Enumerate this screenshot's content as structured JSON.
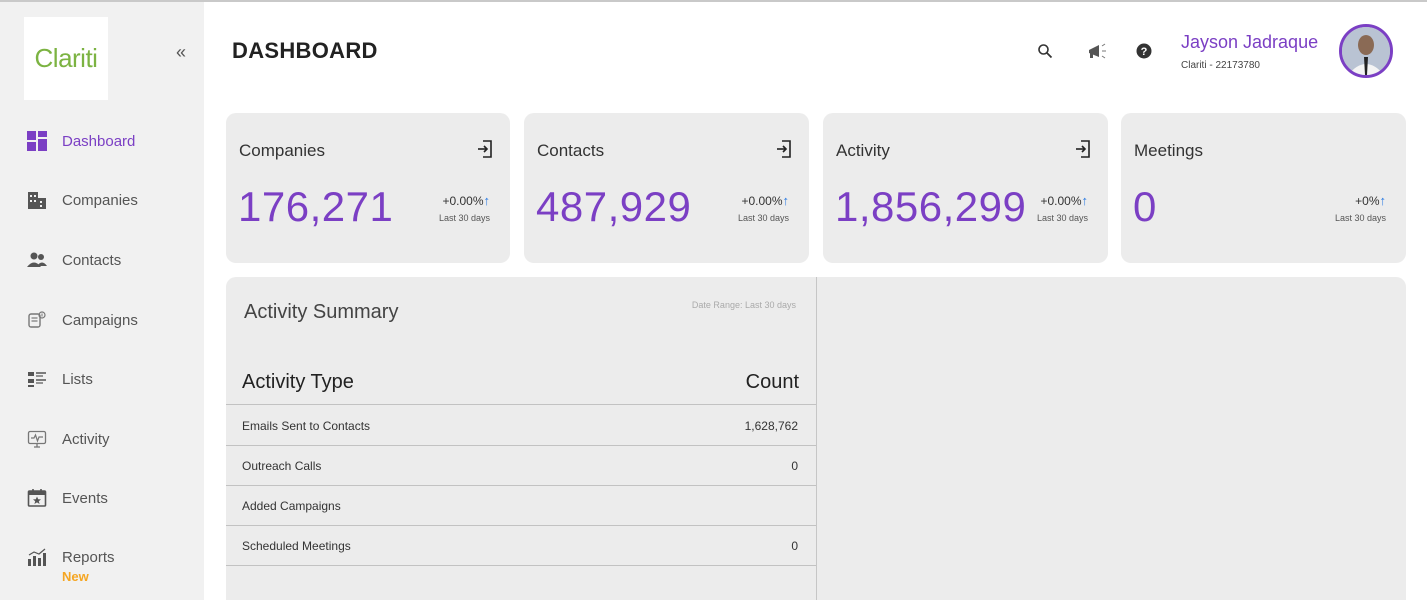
{
  "brand": {
    "logo_text": "Clariti",
    "collapse_glyph": "«"
  },
  "sidebar": {
    "items": [
      {
        "label": "Dashboard",
        "icon": "dashboard-grid-icon",
        "active": true
      },
      {
        "label": "Companies",
        "icon": "building-icon"
      },
      {
        "label": "Contacts",
        "icon": "people-icon"
      },
      {
        "label": "Campaigns",
        "icon": "campaign-icon"
      },
      {
        "label": "Lists",
        "icon": "list-icon"
      },
      {
        "label": "Activity",
        "icon": "activity-monitor-icon"
      },
      {
        "label": "Events",
        "icon": "calendar-star-icon"
      },
      {
        "label": "Reports",
        "icon": "bar-chart-icon",
        "badge": "New"
      }
    ]
  },
  "header": {
    "title": "DASHBOARD",
    "icons": [
      "search-icon",
      "megaphone-icon",
      "help-icon"
    ],
    "user": {
      "name": "Jayson Jadraque",
      "subtitle": "Clariti  -  22173780"
    }
  },
  "stats": [
    {
      "title": "Companies",
      "value": "176,271",
      "change": "+0.00%",
      "period": "Last 30 days",
      "exportable": true
    },
    {
      "title": "Contacts",
      "value": "487,929",
      "change": "+0.00%",
      "period": "Last 30 days",
      "exportable": true
    },
    {
      "title": "Activity",
      "value": "1,856,299",
      "change": "+0.00%",
      "period": "Last 30 days",
      "exportable": true
    },
    {
      "title": "Meetings",
      "value": "0",
      "change": "+0%",
      "period": "Last 30 days",
      "exportable": false
    }
  ],
  "activity_summary": {
    "title": "Activity Summary",
    "date_range": "Date Range: Last 30 days",
    "columns": {
      "type": "Activity Type",
      "count": "Count"
    },
    "rows": [
      {
        "type": "Emails Sent to Contacts",
        "count": "1,628,762"
      },
      {
        "type": "Outreach Calls",
        "count": "0"
      },
      {
        "type": "Added Campaigns",
        "count": ""
      },
      {
        "type": "Scheduled Meetings",
        "count": "0"
      }
    ]
  },
  "colors": {
    "accent": "#7b3fc4",
    "logo": "#7cb342",
    "badge": "#f5a623",
    "trend_up": "#2a7ae2",
    "card_bg": "#ececec",
    "sidebar_bg": "#f1f1f1"
  }
}
